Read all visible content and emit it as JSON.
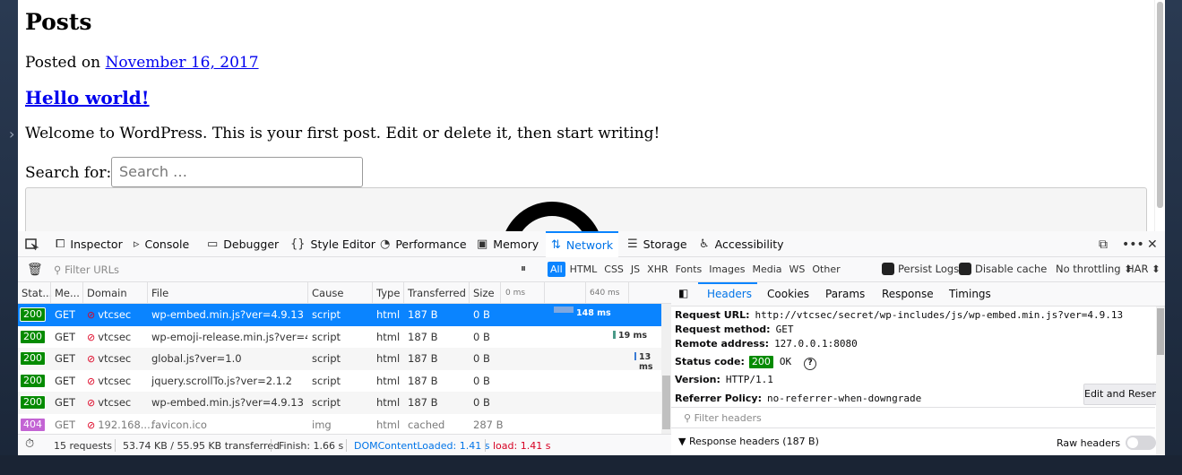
{
  "page": {
    "title": "Posts",
    "posted_prefix": "Posted on ",
    "posted_date": "November 16, 2017",
    "post_title": "Hello world!",
    "post_body": "Welcome to WordPress. This is your first post. Edit or delete it, then start writing!",
    "search_label": "Search for:",
    "search_placeholder": "Search …"
  },
  "devtools": {
    "tabs": {
      "inspector": "Inspector",
      "console": "Console",
      "debugger": "Debugger",
      "style_editor": "Style Editor",
      "performance": "Performance",
      "memory": "Memory",
      "network": "Network",
      "storage": "Storage",
      "accessibility": "Accessibility"
    },
    "filter_placeholder": "Filter URLs",
    "types": [
      "All",
      "HTML",
      "CSS",
      "JS",
      "XHR",
      "Fonts",
      "Images",
      "Media",
      "WS",
      "Other"
    ],
    "persist_logs": "Persist Logs",
    "disable_cache": "Disable cache",
    "throttling": "No throttling ⬍",
    "har": "HAR ⬍",
    "columns": {
      "status": "Stat...",
      "method": "Me...",
      "domain": "Domain",
      "file": "File",
      "cause": "Cause",
      "type": "Type",
      "transferred": "Transferred",
      "size": "Size",
      "wf0": "0 ms",
      "wf640": "640 ms"
    },
    "rows": [
      {
        "status": "200",
        "method": "GET",
        "domain": "vtcsec",
        "file": "wp-embed.min.js?ver=4.9.13",
        "cause": "script",
        "type": "html",
        "transferred": "187 B",
        "size": "0 B",
        "timing": "148 ms"
      },
      {
        "status": "200",
        "method": "GET",
        "domain": "vtcsec",
        "file": "wp-emoji-release.min.js?ver=4.9...",
        "cause": "script",
        "type": "html",
        "transferred": "187 B",
        "size": "0 B",
        "timing": "19 ms"
      },
      {
        "status": "200",
        "method": "GET",
        "domain": "vtcsec",
        "file": "global.js?ver=1.0",
        "cause": "script",
        "type": "html",
        "transferred": "187 B",
        "size": "0 B",
        "timing": "13 ms"
      },
      {
        "status": "200",
        "method": "GET",
        "domain": "vtcsec",
        "file": "jquery.scrollTo.js?ver=2.1.2",
        "cause": "script",
        "type": "html",
        "transferred": "187 B",
        "size": "0 B",
        "timing": ""
      },
      {
        "status": "200",
        "method": "GET",
        "domain": "vtcsec",
        "file": "wp-embed.min.js?ver=4.9.13",
        "cause": "script",
        "type": "html",
        "transferred": "187 B",
        "size": "0 B",
        "timing": ""
      },
      {
        "status": "404",
        "method": "GET",
        "domain": "192.168....",
        "file": "favicon.ico",
        "cause": "img",
        "type": "html",
        "transferred": "cached",
        "size": "287 B",
        "timing": ""
      }
    ],
    "status_bar": {
      "requests": "15 requests",
      "transferred": "53.74 KB / 55.95 KB transferred",
      "finish": "Finish: 1.66 s",
      "dom_loaded": "DOMContentLoaded: 1.41 s",
      "load": "load: 1.41 s"
    },
    "details": {
      "tabs": [
        "Headers",
        "Cookies",
        "Params",
        "Response",
        "Timings"
      ],
      "request_url_label": "Request URL:",
      "request_url": "http://vtcsec/secret/wp-includes/js/wp-embed.min.js?ver=4.9.13",
      "method_label": "Request method:",
      "method": "GET",
      "remote_label": "Remote address:",
      "remote": "127.0.0.1:8080",
      "status_label": "Status code:",
      "status_code": "200",
      "status_text": "OK",
      "version_label": "Version:",
      "version": "HTTP/1.1",
      "referrer_label": "Referrer Policy:",
      "referrer": "no-referrer-when-downgrade",
      "edit_resend": "Edit and Resend",
      "filter_headers": "Filter headers",
      "response_headers": "Response headers (187 B)",
      "raw_headers": "Raw headers"
    }
  }
}
